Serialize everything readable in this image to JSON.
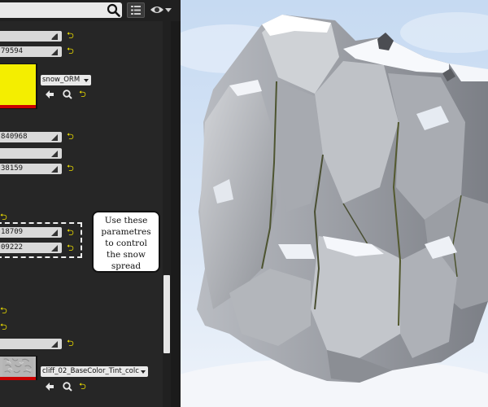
{
  "details_panel": {
    "fields": [
      {
        "value": ""
      },
      {
        "value": "79594"
      },
      {
        "value": "840968"
      },
      {
        "value": ""
      },
      {
        "value": "38159"
      },
      {
        "value": "18709"
      },
      {
        "value": "09222"
      },
      {
        "value": ""
      }
    ],
    "texture_orm": {
      "asset_name": "snow_ORM"
    },
    "texture_cliff": {
      "asset_name": "cliff_02_BaseColor_Tint_colc"
    },
    "reset_glyph": "⮌"
  },
  "callout": {
    "lines": [
      "Use these",
      "parametres",
      "to control",
      "the snow",
      "spread"
    ]
  },
  "colors": {
    "panel_bg": "#262626",
    "field_bg": "#d9d9d9",
    "reset_arrow": "#e6d700",
    "texture_yellow": "#f4ee00",
    "texture_red_bar": "#cc0000",
    "sky": "#cfe0f4"
  },
  "icons": [
    "search-icon",
    "grid-view-icon",
    "eye-icon",
    "arrow-left-icon",
    "magnifier-icon",
    "reset-arrow-icon",
    "drag-grip-icon"
  ]
}
